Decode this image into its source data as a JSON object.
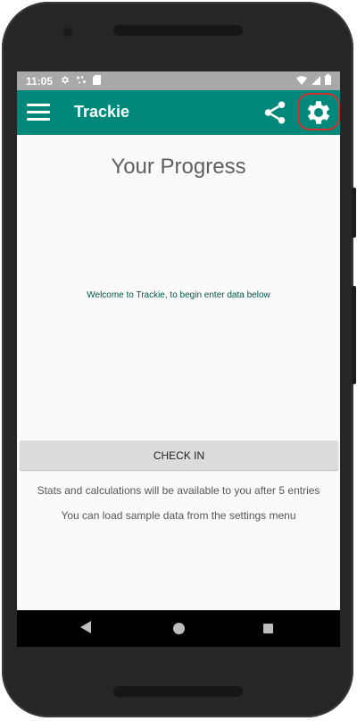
{
  "status_bar": {
    "time": "11:05",
    "left_icons": [
      "gear-icon",
      "network-icon",
      "sd-card-icon"
    ],
    "right_icons": [
      "wifi-icon",
      "signal-icon",
      "battery-icon"
    ]
  },
  "app_bar": {
    "title": "Trackie",
    "icons": [
      "menu-icon",
      "share-icon",
      "settings-icon"
    ],
    "color": "#00897b"
  },
  "main": {
    "title": "Your Progress",
    "welcome_text": "Welcome to Trackie, to begin enter data below",
    "checkin_label": "CHECK IN",
    "info_entries": "Stats and calculations will be available to you after 5 entries",
    "info_sample": "You can load sample data from the settings menu"
  },
  "nav_bar": {
    "icons": [
      "back-icon",
      "home-icon",
      "recents-icon"
    ]
  },
  "annotation": {
    "highlight_color": "#d32f2f"
  }
}
